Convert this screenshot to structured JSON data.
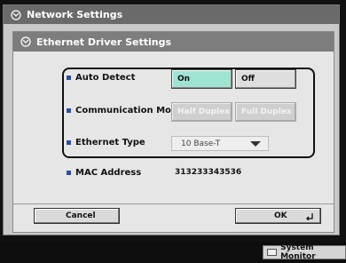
{
  "window": {
    "title": "Network Settings"
  },
  "dialog": {
    "title": "Ethernet Driver Settings"
  },
  "settings": {
    "auto_detect": {
      "label": "Auto Detect",
      "on_label": "On",
      "off_label": "Off",
      "selected": "On"
    },
    "communication_mode": {
      "label": "Communication Mode",
      "half_label": "Half Duplex",
      "full_label": "Full Duplex"
    },
    "ethernet_type": {
      "label": "Ethernet Type",
      "value": "10 Base-T"
    },
    "mac_address": {
      "label": "MAC Address",
      "value": "313233343536"
    }
  },
  "footer": {
    "cancel_label": "Cancel",
    "ok_label": "OK"
  },
  "status_bar": {
    "system_monitor_label": "System Monitor"
  },
  "colors": {
    "selected_button": "#9fe3d3",
    "bullet": "#2c4fa0",
    "header_dark": "#6a6a6a"
  }
}
